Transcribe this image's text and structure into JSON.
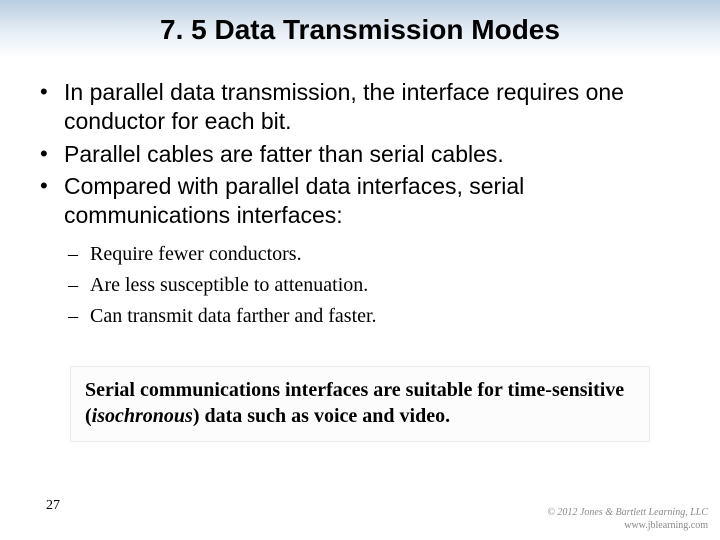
{
  "title": "7. 5 Data Transmission Modes",
  "bullets": [
    "In parallel data transmission, the interface requires one conductor for each bit.",
    "Parallel cables are fatter than serial cables.",
    "Compared with parallel data interfaces, serial communications interfaces:"
  ],
  "sub_bullets": [
    "Require fewer conductors.",
    "Are less susceptible to attenuation.",
    "Can transmit data farther and faster."
  ],
  "callout": {
    "pre": "Serial communications interfaces are suitable for time-sensitive (",
    "iso": "isochronous",
    "post": ") data such as voice and video."
  },
  "page_number": "27",
  "footer": {
    "line1": "© 2012 Jones & Bartlett Learning, LLC",
    "line2": "www.jblearning.com"
  }
}
